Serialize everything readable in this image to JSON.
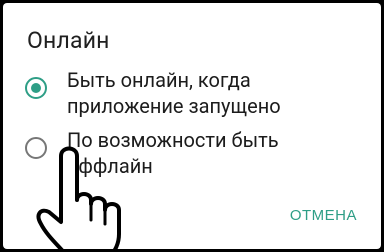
{
  "dialog": {
    "title": "Онлайн",
    "options": [
      {
        "label": "Быть онлайн, когда приложение запущено",
        "selected": true
      },
      {
        "label": "По возможности быть оффлайн",
        "selected": false
      }
    ],
    "cancel_label": "ОТМЕНА"
  },
  "colors": {
    "accent": "#2e9e86",
    "text": "#1c1c1c",
    "background": "#ffffff"
  },
  "icons": {
    "pointer": "pointing-hand-icon"
  }
}
